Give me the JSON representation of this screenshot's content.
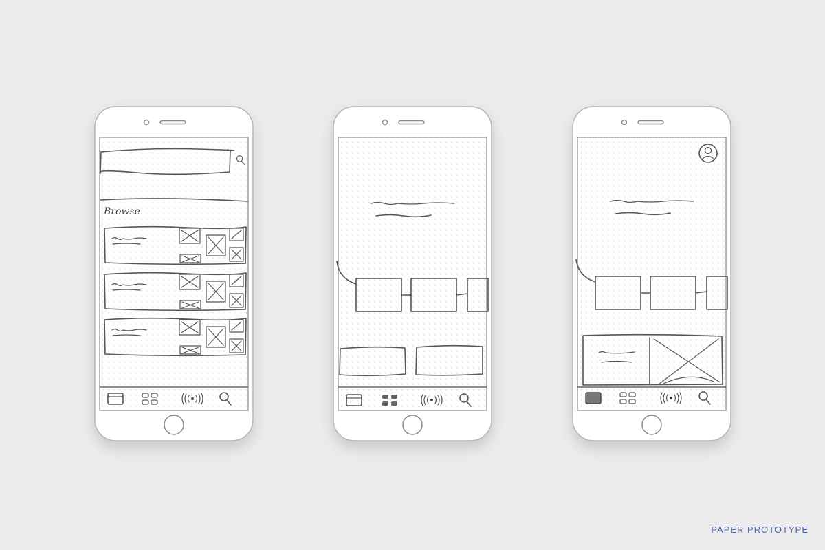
{
  "phones": [
    {
      "screen": "browse",
      "browse_heading": "Browse",
      "active_tab": "search"
    },
    {
      "screen": "home-flow",
      "active_tab": "grid"
    },
    {
      "screen": "home-profile",
      "active_tab": "calendar"
    }
  ],
  "tab_icons": [
    "calendar-icon",
    "grid-icon",
    "broadcast-icon",
    "search-icon"
  ],
  "caption": "PAPER PROTOTYPE",
  "colors": {
    "background": "#ececec",
    "caption": "#5566a0",
    "sketch": "#555555"
  }
}
